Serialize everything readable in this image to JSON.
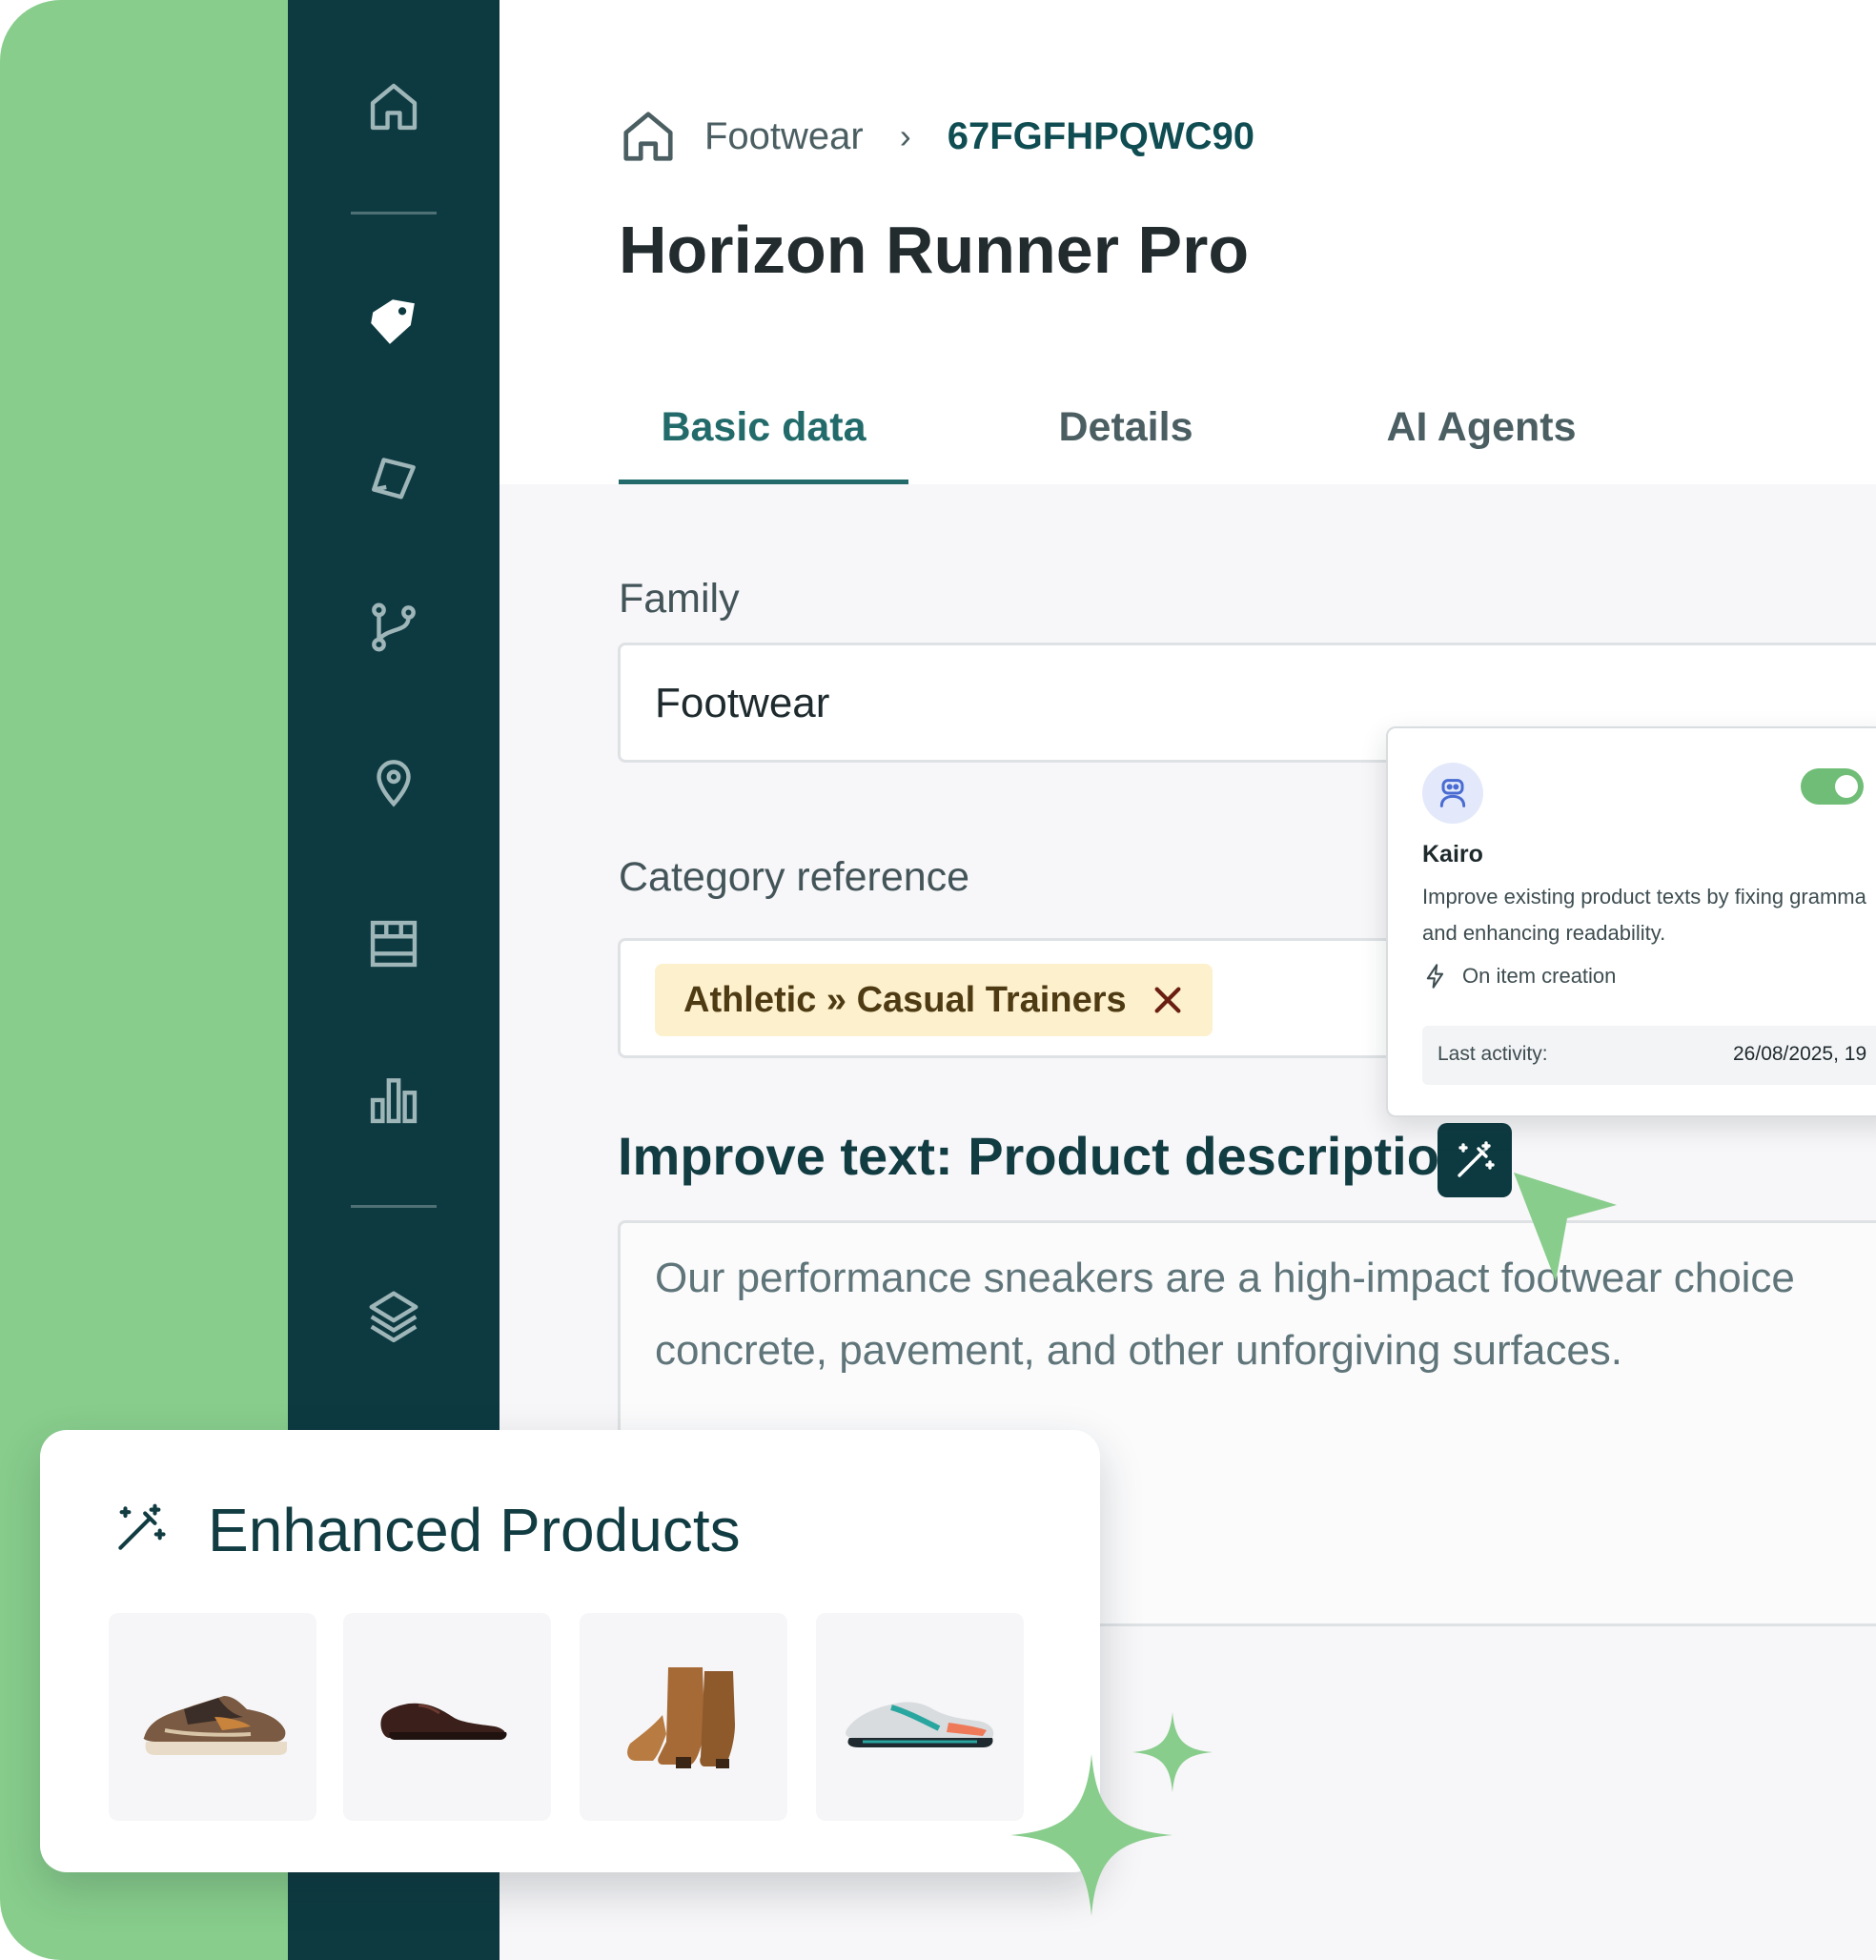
{
  "breadcrumb": {
    "family": "Footwear",
    "separator": "›",
    "item_id": "67FGFHPQWC90"
  },
  "product": {
    "title": "Horizon Runner Pro"
  },
  "tabs": [
    {
      "label": "Basic data",
      "active": true
    },
    {
      "label": "Details",
      "active": false
    },
    {
      "label": "AI Agents",
      "active": false
    }
  ],
  "form": {
    "family_label": "Family",
    "family_value": "Footwear",
    "category_label": "Category reference",
    "category_chip": "Athletic » Casual Trainers"
  },
  "improve": {
    "title_bold": "Improve text:",
    "title_rest": " Product description",
    "description": "Our performance sneakers are a high-impact footwear choice\nconcrete, pavement, and other unforgiving surfaces."
  },
  "agent": {
    "name": "Kairo",
    "description": "Improve existing product texts by fixing gramma\nand enhancing readability.",
    "trigger": "On item creation",
    "last_activity_label": "Last activity:",
    "last_activity_value": "26/08/2025, 19",
    "enabled": true
  },
  "enhanced": {
    "title": "Enhanced Products",
    "products": [
      "casual-sneaker",
      "oxford-shoe",
      "ankle-boot",
      "running-shoe"
    ]
  },
  "colors": {
    "brand_green": "#88cd8c",
    "sidebar": "#0d3a41",
    "accent_teal": "#236b6b",
    "chip_bg": "#fdf0cc"
  },
  "icons": {
    "sidebar": [
      "home-icon",
      "tag-icon",
      "shapes-icon",
      "branch-icon",
      "location-pin-icon",
      "grid-icon",
      "bar-chart-icon",
      "layers-icon"
    ],
    "breadcrumb": "home-icon",
    "improve_button": "magic-wand-icon",
    "agent_avatar": "robot-icon",
    "agent_trigger": "lightning-icon"
  }
}
